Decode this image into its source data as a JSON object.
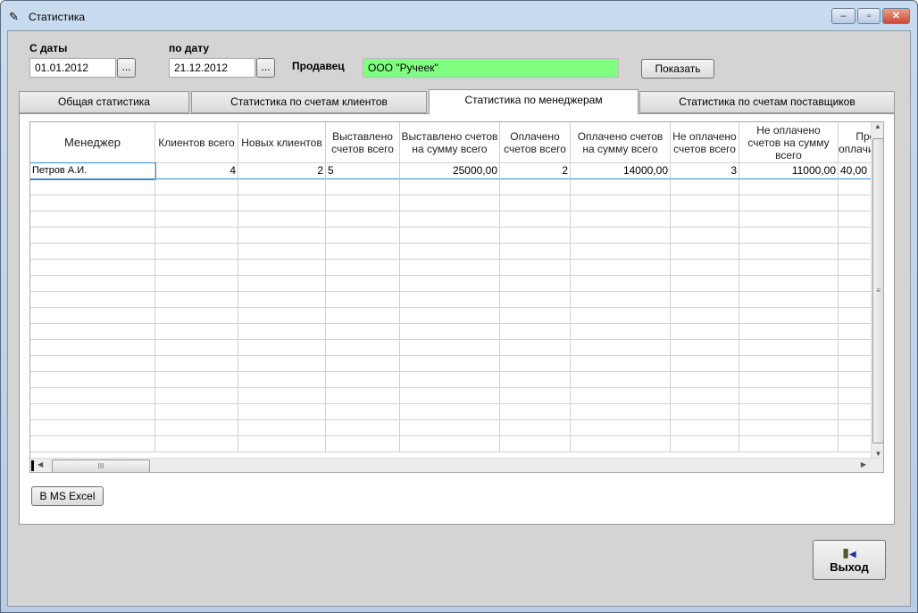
{
  "window": {
    "title": "Статистика",
    "icon": "app-icon",
    "controls": [
      "minimize",
      "maximize",
      "close"
    ]
  },
  "filters": {
    "from_label": "С даты",
    "from_value": "01.01.2012",
    "to_label": "по дату",
    "to_value": "21.12.2012",
    "picker_label": "...",
    "seller_label": "Продавец",
    "seller_value": "ООО \"Ручеек\"",
    "show_label": "Показать"
  },
  "tabs": [
    {
      "label": "Общая статистика"
    },
    {
      "label": "Статистика по счетам клиентов"
    },
    {
      "label": "Статистика по менеджерам",
      "active": true
    },
    {
      "label": "Статистика по счетам поставщиков"
    }
  ],
  "table": {
    "columns": [
      "Менеджер",
      "Клиентов всего",
      "Новых клиентов",
      "Выставлено счетов всего",
      "Выставлено счетов на сумму всего",
      "Оплачено счетов всего",
      "Оплачено счетов на сумму всего",
      "Не оплачено счетов всего",
      "Не оплачено счетов на сумму всего",
      "Процент оплачиваемости"
    ],
    "rows": [
      [
        "Петров А.И.",
        "4",
        "2",
        "5",
        "25000,00",
        "2",
        "14000,00",
        "3",
        "11000,00",
        "40,00"
      ]
    ]
  },
  "excel_label": "В MS Excel",
  "exit_label": "Выход",
  "colors": {
    "seller_bg": "#80ff80",
    "panel_bg": "#d4d4d4"
  }
}
